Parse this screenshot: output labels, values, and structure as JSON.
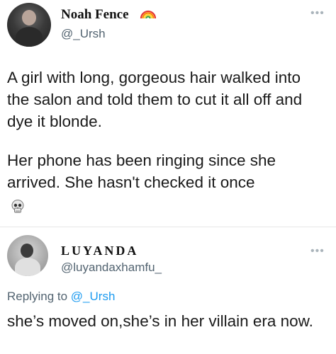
{
  "tweet": {
    "author_name": "Noah Fence",
    "author_handle": "@_Ursh",
    "more_icon": "more-dots-icon",
    "badge_icon": "rainbow-icon",
    "paragraph1": "A girl with long, gorgeous hair walked into the salon and told them to cut it all off and dye it blonde.",
    "paragraph2": "Her phone has been ringing since she arrived. She hasn't checked it once",
    "emoji_icon": "skull-icon"
  },
  "reply": {
    "author_name": "LUYANDA",
    "author_handle": "@luyandaxhamfu_",
    "replying_label": "Replying to",
    "replying_handle": "@_Ursh",
    "text": "she’s moved on,she’s in her villain era now."
  },
  "colors": {
    "handle_gray": "#536471",
    "link_blue": "#1d9bf0"
  }
}
